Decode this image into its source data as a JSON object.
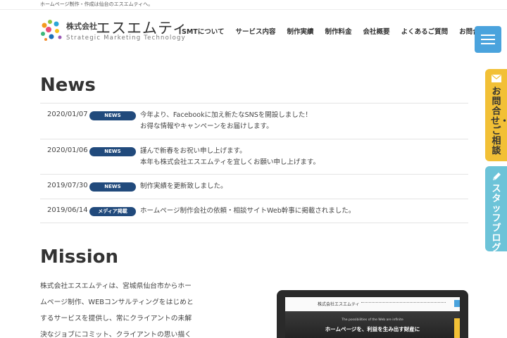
{
  "topbar": {
    "tagline": "ホームページ制作・作成は仙台のエスエムティへ。"
  },
  "logo": {
    "company": "株式会社",
    "brand": "エスエムティ",
    "sub": "Strategic Marketing Technology",
    "icon": "colorful-dots-icon"
  },
  "nav": {
    "items": [
      {
        "label": "SMTについて"
      },
      {
        "label": "サービス内容"
      },
      {
        "label": "制作実績"
      },
      {
        "label": "制作料金"
      },
      {
        "label": "会社概要"
      },
      {
        "label": "よくあるご質問"
      },
      {
        "label": "お問合せ"
      }
    ],
    "menu_icon": "hamburger-menu-icon"
  },
  "side_tabs": {
    "contact": {
      "label": "お問合せ・ご相談",
      "icon": "mail-icon",
      "color": "#f2c036"
    },
    "blog": {
      "label": "スタッフブログ",
      "icon": "pencil-icon",
      "color": "#6cc3d8"
    }
  },
  "news": {
    "title": "News",
    "items": [
      {
        "date": "2020/01/07",
        "badge": "NEWS",
        "lines": [
          "今年より、Facebookに加え新たなSNSを開設しました！",
          "お得な情報やキャンペーンをお届けします。"
        ]
      },
      {
        "date": "2020/01/06",
        "badge": "NEWS",
        "lines": [
          "謹んで新春をお祝い申し上げます。",
          "本年も株式会社エスエムティを宜しくお願い申し上げます。"
        ]
      },
      {
        "date": "2019/07/30",
        "badge": "NEWS",
        "lines": [
          "制作実績を更新致しました。"
        ]
      },
      {
        "date": "2019/06/14",
        "badge": "メディア掲載",
        "lines": [
          "ホームページ制作会社の依頼・相談サイトWeb幹事に掲載されました。"
        ]
      }
    ]
  },
  "mission": {
    "title": "Mission",
    "lines": [
      "株式会社エスエムティは、宮城県仙台市からホー",
      "ムページ制作、WEBコンサルティングをはじめと",
      "するサービスを提供し、常にクライアントの未解",
      "決なジョブにコミット、クライアントの思い描く"
    ]
  },
  "laptop": {
    "mini_logo": "株式会社エスエムティ",
    "hero_small": "The possibilities of the Web are infinite",
    "hero_main": "ホームページを、利益を生み出す財産に"
  },
  "colors": {
    "badge": "#214a7c",
    "accent": "#4aa3dd"
  }
}
